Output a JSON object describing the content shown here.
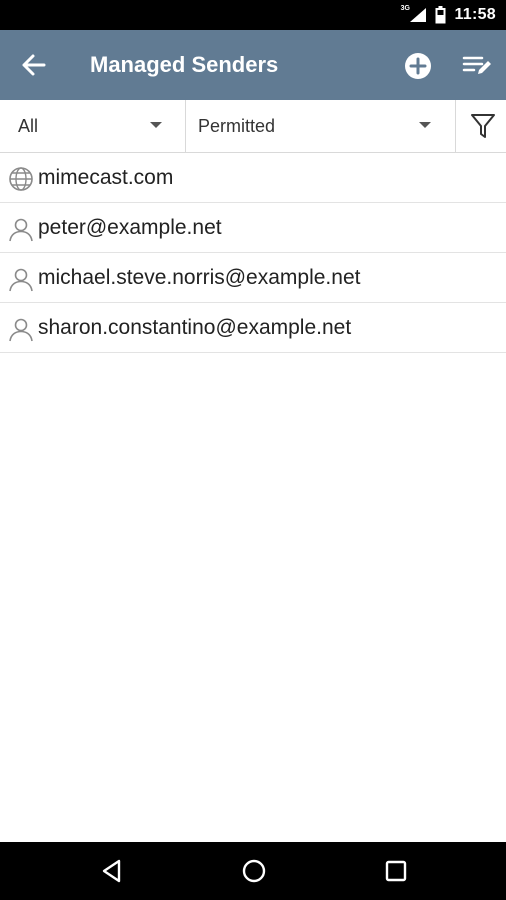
{
  "status_bar": {
    "network_label": "3G",
    "clock": "11:58",
    "icons": [
      "signal-icon",
      "battery-icon"
    ]
  },
  "app_bar": {
    "title": "Managed Senders",
    "icons": [
      "back-arrow-icon",
      "add-circle-icon",
      "edit-list-icon"
    ]
  },
  "filters": {
    "scope_selected": "All",
    "status_selected": "Permitted",
    "filter_icon": "funnel-icon"
  },
  "senders": [
    {
      "icon": "globe-icon",
      "label": "mimecast.com"
    },
    {
      "icon": "person-icon",
      "label": "peter@example.net"
    },
    {
      "icon": "person-icon",
      "label": "michael.steve.norris@example.net"
    },
    {
      "icon": "person-icon",
      "label": "sharon.constantino@example.net"
    }
  ],
  "nav_bar": {
    "icons": [
      "nav-back-icon",
      "nav-home-icon",
      "nav-recents-icon"
    ]
  },
  "colors": {
    "app_bar": "#617b93",
    "status_bar": "#000000",
    "nav_bar": "#000000",
    "divider": "#d9d9d9",
    "text": "#222222",
    "icon_gray": "#8a8a8a"
  }
}
